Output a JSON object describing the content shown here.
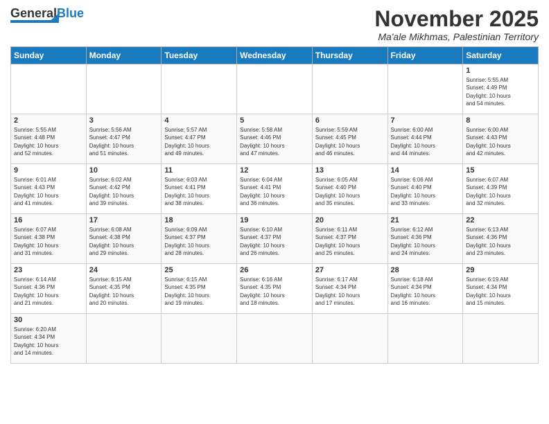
{
  "header": {
    "logo_general": "General",
    "logo_blue": "Blue",
    "month_title": "November 2025",
    "location": "Ma'ale Mikhmas, Palestinian Territory"
  },
  "days_of_week": [
    "Sunday",
    "Monday",
    "Tuesday",
    "Wednesday",
    "Thursday",
    "Friday",
    "Saturday"
  ],
  "weeks": [
    [
      {
        "day": "",
        "info": ""
      },
      {
        "day": "",
        "info": ""
      },
      {
        "day": "",
        "info": ""
      },
      {
        "day": "",
        "info": ""
      },
      {
        "day": "",
        "info": ""
      },
      {
        "day": "",
        "info": ""
      },
      {
        "day": "1",
        "info": "Sunrise: 5:55 AM\nSunset: 4:49 PM\nDaylight: 10 hours\nand 54 minutes."
      }
    ],
    [
      {
        "day": "2",
        "info": "Sunrise: 5:55 AM\nSunset: 4:48 PM\nDaylight: 10 hours\nand 52 minutes."
      },
      {
        "day": "3",
        "info": "Sunrise: 5:56 AM\nSunset: 4:47 PM\nDaylight: 10 hours\nand 51 minutes."
      },
      {
        "day": "4",
        "info": "Sunrise: 5:57 AM\nSunset: 4:47 PM\nDaylight: 10 hours\nand 49 minutes."
      },
      {
        "day": "5",
        "info": "Sunrise: 5:58 AM\nSunset: 4:46 PM\nDaylight: 10 hours\nand 47 minutes."
      },
      {
        "day": "6",
        "info": "Sunrise: 5:59 AM\nSunset: 4:45 PM\nDaylight: 10 hours\nand 46 minutes."
      },
      {
        "day": "7",
        "info": "Sunrise: 6:00 AM\nSunset: 4:44 PM\nDaylight: 10 hours\nand 44 minutes."
      },
      {
        "day": "8",
        "info": "Sunrise: 6:00 AM\nSunset: 4:43 PM\nDaylight: 10 hours\nand 42 minutes."
      }
    ],
    [
      {
        "day": "9",
        "info": "Sunrise: 6:01 AM\nSunset: 4:43 PM\nDaylight: 10 hours\nand 41 minutes."
      },
      {
        "day": "10",
        "info": "Sunrise: 6:02 AM\nSunset: 4:42 PM\nDaylight: 10 hours\nand 39 minutes."
      },
      {
        "day": "11",
        "info": "Sunrise: 6:03 AM\nSunset: 4:41 PM\nDaylight: 10 hours\nand 38 minutes."
      },
      {
        "day": "12",
        "info": "Sunrise: 6:04 AM\nSunset: 4:41 PM\nDaylight: 10 hours\nand 36 minutes."
      },
      {
        "day": "13",
        "info": "Sunrise: 6:05 AM\nSunset: 4:40 PM\nDaylight: 10 hours\nand 35 minutes."
      },
      {
        "day": "14",
        "info": "Sunrise: 6:06 AM\nSunset: 4:40 PM\nDaylight: 10 hours\nand 33 minutes."
      },
      {
        "day": "15",
        "info": "Sunrise: 6:07 AM\nSunset: 4:39 PM\nDaylight: 10 hours\nand 32 minutes."
      }
    ],
    [
      {
        "day": "16",
        "info": "Sunrise: 6:07 AM\nSunset: 4:38 PM\nDaylight: 10 hours\nand 31 minutes."
      },
      {
        "day": "17",
        "info": "Sunrise: 6:08 AM\nSunset: 4:38 PM\nDaylight: 10 hours\nand 29 minutes."
      },
      {
        "day": "18",
        "info": "Sunrise: 6:09 AM\nSunset: 4:37 PM\nDaylight: 10 hours\nand 28 minutes."
      },
      {
        "day": "19",
        "info": "Sunrise: 6:10 AM\nSunset: 4:37 PM\nDaylight: 10 hours\nand 26 minutes."
      },
      {
        "day": "20",
        "info": "Sunrise: 6:11 AM\nSunset: 4:37 PM\nDaylight: 10 hours\nand 25 minutes."
      },
      {
        "day": "21",
        "info": "Sunrise: 6:12 AM\nSunset: 4:36 PM\nDaylight: 10 hours\nand 24 minutes."
      },
      {
        "day": "22",
        "info": "Sunrise: 6:13 AM\nSunset: 4:36 PM\nDaylight: 10 hours\nand 23 minutes."
      }
    ],
    [
      {
        "day": "23",
        "info": "Sunrise: 6:14 AM\nSunset: 4:36 PM\nDaylight: 10 hours\nand 21 minutes."
      },
      {
        "day": "24",
        "info": "Sunrise: 6:15 AM\nSunset: 4:35 PM\nDaylight: 10 hours\nand 20 minutes."
      },
      {
        "day": "25",
        "info": "Sunrise: 6:15 AM\nSunset: 4:35 PM\nDaylight: 10 hours\nand 19 minutes."
      },
      {
        "day": "26",
        "info": "Sunrise: 6:16 AM\nSunset: 4:35 PM\nDaylight: 10 hours\nand 18 minutes."
      },
      {
        "day": "27",
        "info": "Sunrise: 6:17 AM\nSunset: 4:34 PM\nDaylight: 10 hours\nand 17 minutes."
      },
      {
        "day": "28",
        "info": "Sunrise: 6:18 AM\nSunset: 4:34 PM\nDaylight: 10 hours\nand 16 minutes."
      },
      {
        "day": "29",
        "info": "Sunrise: 6:19 AM\nSunset: 4:34 PM\nDaylight: 10 hours\nand 15 minutes."
      }
    ],
    [
      {
        "day": "30",
        "info": "Sunrise: 6:20 AM\nSunset: 4:34 PM\nDaylight: 10 hours\nand 14 minutes."
      },
      {
        "day": "",
        "info": ""
      },
      {
        "day": "",
        "info": ""
      },
      {
        "day": "",
        "info": ""
      },
      {
        "day": "",
        "info": ""
      },
      {
        "day": "",
        "info": ""
      },
      {
        "day": "",
        "info": ""
      }
    ]
  ]
}
